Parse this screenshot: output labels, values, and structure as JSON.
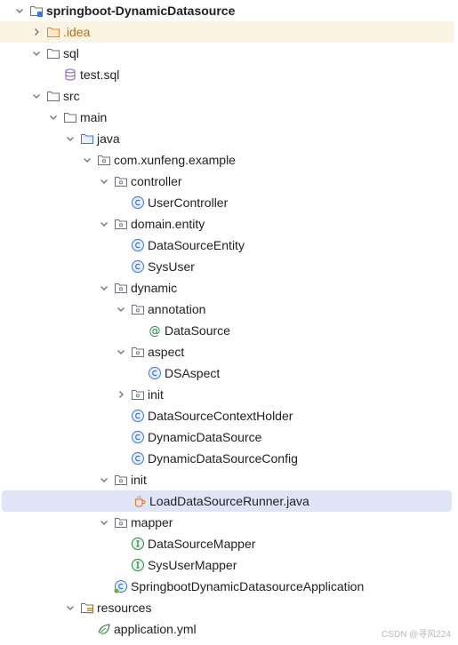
{
  "tree": {
    "rows": [
      {
        "label": "springboot-DynamicDatasource",
        "icon": "module-folder-icon",
        "expanded": true
      },
      {
        "label": ".idea",
        "icon": "excluded-folder-icon",
        "expanded": false
      },
      {
        "label": "sql",
        "icon": "folder-icon",
        "expanded": true
      },
      {
        "label": "test.sql",
        "icon": "sql-file-icon"
      },
      {
        "label": "src",
        "icon": "folder-icon",
        "expanded": true
      },
      {
        "label": "main",
        "icon": "folder-icon",
        "expanded": true
      },
      {
        "label": "java",
        "icon": "source-root-folder-icon",
        "expanded": true
      },
      {
        "label": "com.xunfeng.example",
        "icon": "package-icon",
        "expanded": true
      },
      {
        "label": "controller",
        "icon": "package-icon",
        "expanded": true
      },
      {
        "label": "UserController",
        "icon": "class-icon"
      },
      {
        "label": "domain.entity",
        "icon": "package-icon",
        "expanded": true
      },
      {
        "label": "DataSourceEntity",
        "icon": "class-icon"
      },
      {
        "label": "SysUser",
        "icon": "class-icon"
      },
      {
        "label": "dynamic",
        "icon": "package-icon",
        "expanded": true
      },
      {
        "label": "annotation",
        "icon": "package-icon",
        "expanded": true
      },
      {
        "label": "DataSource",
        "icon": "annotation-icon"
      },
      {
        "label": "aspect",
        "icon": "package-icon",
        "expanded": true
      },
      {
        "label": "DSAspect",
        "icon": "class-icon"
      },
      {
        "label": "init",
        "icon": "package-icon",
        "expanded": false
      },
      {
        "label": "DataSourceContextHolder",
        "icon": "class-icon"
      },
      {
        "label": "DynamicDataSource",
        "icon": "class-icon"
      },
      {
        "label": "DynamicDataSourceConfig",
        "icon": "class-icon"
      },
      {
        "label": "init",
        "icon": "package-icon",
        "expanded": true
      },
      {
        "label": "LoadDataSourceRunner.java",
        "icon": "java-file-icon",
        "selected": true
      },
      {
        "label": "mapper",
        "icon": "package-icon",
        "expanded": true
      },
      {
        "label": "DataSourceMapper",
        "icon": "interface-icon"
      },
      {
        "label": "SysUserMapper",
        "icon": "interface-icon"
      },
      {
        "label": "SpringbootDynamicDatasourceApplication",
        "icon": "spring-boot-class-icon"
      },
      {
        "label": "resources",
        "icon": "resources-folder-icon",
        "expanded": true
      },
      {
        "label": "application.yml",
        "icon": "yaml-file-icon"
      }
    ]
  },
  "watermark": "CSDN @寻风224",
  "colors": {
    "selection": "#dfe5f6",
    "excluded_row": "#fcf4e3",
    "excluded_text": "#b06f1e",
    "class_icon": "#3574f0",
    "interface_icon": "#208a3c",
    "folder_icon": "#6c707e"
  }
}
